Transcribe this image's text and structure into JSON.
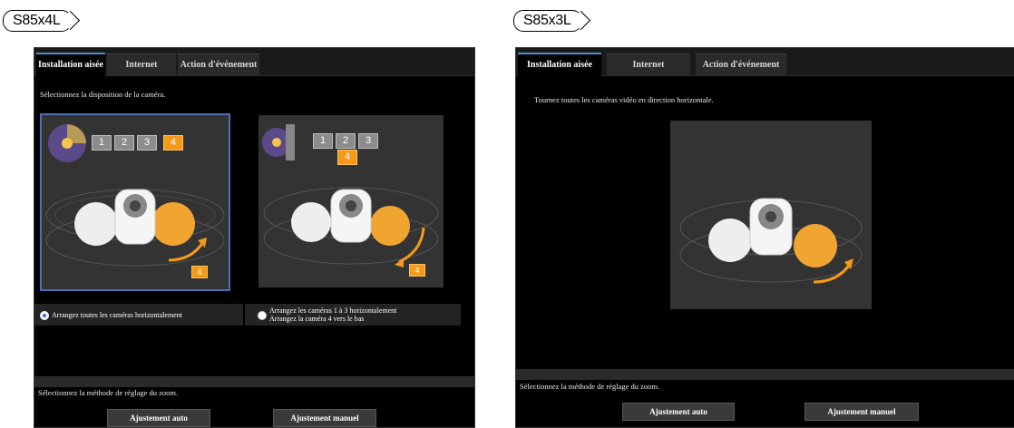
{
  "left": {
    "model": "S85x4L",
    "tabs": [
      "Installation aisée",
      "Internet",
      "Action d'événement"
    ],
    "instruction": "Sélectionnez la disposition de la caméra.",
    "option_a": {
      "boxes": [
        "1",
        "2",
        "3",
        "4"
      ],
      "selected_box": "4",
      "arrow_badge": "4"
    },
    "option_b": {
      "boxes": [
        "1",
        "2",
        "3"
      ],
      "sub_box": "4",
      "arrow_badge": "4"
    },
    "radio_a": "Arrangez toutes les caméras horizontalement",
    "radio_b_line1": "Arrangez les caméras 1 à 3 horizontalement",
    "radio_b_line2": "Arrangez la caméra 4 vers le bas",
    "zoom_label": "Sélectionnez la méthode de réglage du zoom.",
    "btn_auto": "Ajustement auto",
    "btn_manual": "Ajustement manuel"
  },
  "right": {
    "model": "S85x3L",
    "tabs": [
      "Installation aisée",
      "Internet",
      "Action d'événement"
    ],
    "instruction": "Tournez toutes les caméras vidéo en direction horizontale.",
    "zoom_label": "Sélectionnez la méthode de réglage du zoom.",
    "btn_auto": "Ajustement auto",
    "btn_manual": "Ajustement manuel"
  },
  "colors": {
    "accent": "#f39b18",
    "selection": "#4a6fb5",
    "radio": "#3d6fd9"
  }
}
